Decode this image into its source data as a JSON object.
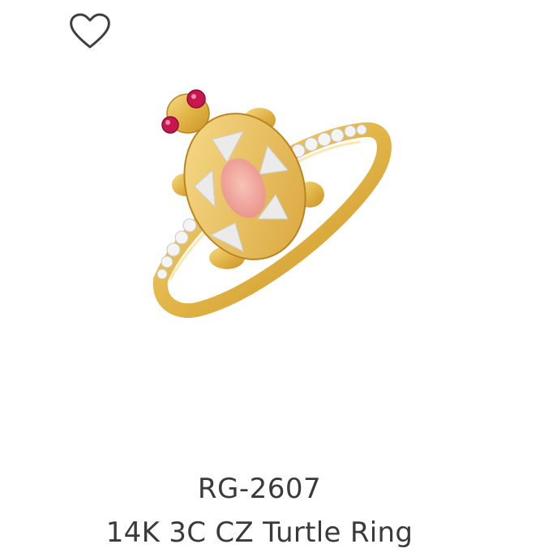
{
  "product": {
    "sku": "RG-2607",
    "title": "14K 3C CZ Turtle Ring"
  },
  "icons": {
    "wishlist": "heart-outline-icon"
  },
  "colors": {
    "text": "#3a3a3a",
    "gold": "#e2b548",
    "coral": "#f0a59a",
    "ruby": "#c8174e"
  }
}
